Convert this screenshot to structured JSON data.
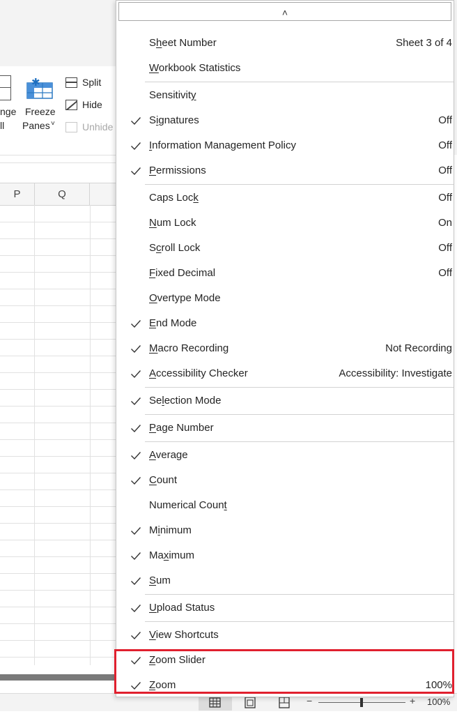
{
  "ribbon": {
    "arrange_label_top": "nge",
    "arrange_label_bottom": "ll",
    "freeze_label_top": "Freeze",
    "freeze_label_bottom": "Panes",
    "freeze_chevron": "˅",
    "split_label": "Split",
    "hide_label": "Hide",
    "unhide_label": "Unhide"
  },
  "columns": [
    "P",
    "Q"
  ],
  "status": {
    "zoom_minus": "−",
    "zoom_plus": "+",
    "zoom_percent": "100%",
    "zoom_level": 100
  },
  "menu": {
    "scroll_up_glyph": "˄",
    "items": [
      {
        "pre": "S",
        "key": "h",
        "post": "eet Number",
        "value": "Sheet 3 of 4",
        "checked": false
      },
      {
        "pre": "",
        "key": "W",
        "post": "orkbook Statistics",
        "value": "",
        "checked": false
      },
      {
        "pre": "Sensitivit",
        "key": "y",
        "post": "",
        "value": "",
        "checked": false
      },
      {
        "pre": "S",
        "key": "i",
        "post": "gnatures",
        "value": "Off",
        "checked": true
      },
      {
        "pre": "",
        "key": "I",
        "post": "nformation Management Policy",
        "value": "Off",
        "checked": true
      },
      {
        "pre": "",
        "key": "P",
        "post": "ermissions",
        "value": "Off",
        "checked": true
      },
      {
        "pre": "Caps Loc",
        "key": "k",
        "post": "",
        "value": "Off",
        "checked": false
      },
      {
        "pre": "",
        "key": "N",
        "post": "um Lock",
        "value": "On",
        "checked": false
      },
      {
        "pre": "S",
        "key": "c",
        "post": "roll Lock",
        "value": "Off",
        "checked": false
      },
      {
        "pre": "",
        "key": "F",
        "post": "ixed Decimal",
        "value": "Off",
        "checked": false
      },
      {
        "pre": "",
        "key": "O",
        "post": "vertype Mode",
        "value": "",
        "checked": false
      },
      {
        "pre": "",
        "key": "E",
        "post": "nd Mode",
        "value": "",
        "checked": true
      },
      {
        "pre": "",
        "key": "M",
        "post": "acro Recording",
        "value": "Not Recording",
        "checked": true
      },
      {
        "pre": "",
        "key": "A",
        "post": "ccessibility Checker",
        "value": "Accessibility: Investigate",
        "checked": true
      },
      {
        "pre": "Se",
        "key": "l",
        "post": "ection Mode",
        "value": "",
        "checked": true
      },
      {
        "pre": "",
        "key": "P",
        "post": "age Number",
        "value": "",
        "checked": true
      },
      {
        "pre": "",
        "key": "A",
        "post": "verage",
        "value": "",
        "checked": true
      },
      {
        "pre": "",
        "key": "C",
        "post": "ount",
        "value": "",
        "checked": true
      },
      {
        "pre": "Numerical Coun",
        "key": "t",
        "post": "",
        "value": "",
        "checked": false
      },
      {
        "pre": "M",
        "key": "i",
        "post": "nimum",
        "value": "",
        "checked": true
      },
      {
        "pre": "Ma",
        "key": "x",
        "post": "imum",
        "value": "",
        "checked": true
      },
      {
        "pre": "",
        "key": "S",
        "post": "um",
        "value": "",
        "checked": true
      },
      {
        "pre": "",
        "key": "U",
        "post": "pload Status",
        "value": "",
        "checked": true
      },
      {
        "pre": "",
        "key": "V",
        "post": "iew Shortcuts",
        "value": "",
        "checked": true
      },
      {
        "pre": "",
        "key": "Z",
        "post": "oom Slider",
        "value": "",
        "checked": true
      },
      {
        "pre": "",
        "key": "Z",
        "post": "oom",
        "value": "100%",
        "checked": true
      }
    ]
  }
}
